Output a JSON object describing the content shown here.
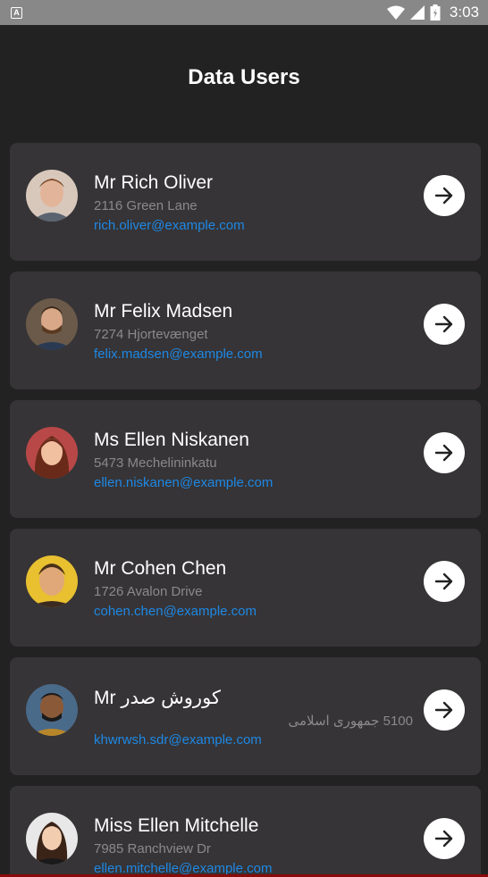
{
  "status_bar": {
    "time": "3:03",
    "icons": [
      "notification-a-icon",
      "wifi-icon",
      "signal-icon",
      "battery-icon"
    ],
    "notification_glyph": "A"
  },
  "header": {
    "title": "Data Users"
  },
  "users": [
    {
      "name": "Mr Rich Oliver",
      "address": "2116 Green Lane",
      "email": "rich.oliver@example.com"
    },
    {
      "name": "Mr Felix Madsen",
      "address": "7274 Hjortevænget",
      "email": "felix.madsen@example.com"
    },
    {
      "name": "Ms Ellen Niskanen",
      "address": "5473 Mechelininkatu",
      "email": "ellen.niskanen@example.com"
    },
    {
      "name": "Mr Cohen Chen",
      "address": "1726 Avalon Drive",
      "email": "cohen.chen@example.com"
    },
    {
      "name": "Mr کوروش صدر",
      "address": "5100 جمهوری اسلامی",
      "email": "khwrwsh.sdr@example.com"
    },
    {
      "name": "Miss Ellen Mitchelle",
      "address": "7985 Ranchview Dr",
      "email": "ellen.mitchelle@example.com"
    }
  ],
  "colors": {
    "background": "#222223",
    "card": "#363436",
    "email": "#1e88e5",
    "address": "#8a8a8a",
    "status_bar": "#888888"
  },
  "arrow_icon": "arrow-right-icon"
}
